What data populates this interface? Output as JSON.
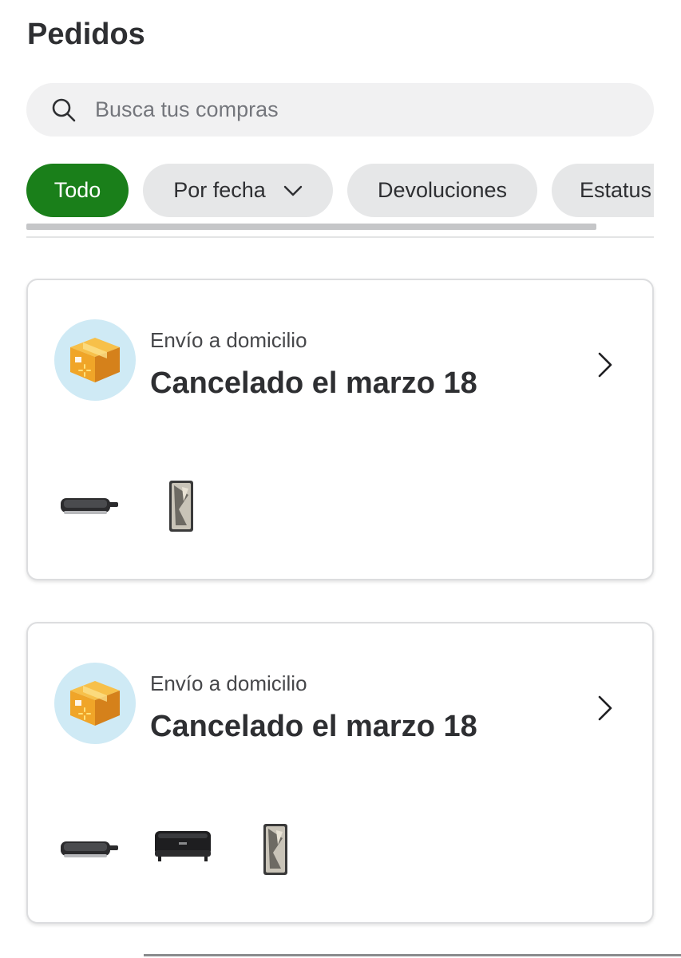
{
  "header": {
    "title": "Pedidos"
  },
  "search": {
    "placeholder": "Busca tus compras",
    "icon": "search-icon"
  },
  "filters": [
    {
      "label": "Todo",
      "active": true
    },
    {
      "label": "Por fecha",
      "active": false,
      "icon": "chevron-down-icon"
    },
    {
      "label": "Devoluciones",
      "active": false
    },
    {
      "label": "Estatus",
      "active": false
    }
  ],
  "orders": [
    {
      "type": "Envío a domicilio",
      "status": "Cancelado el marzo 18",
      "products": [
        "griddle-product-image",
        "phone-product-image"
      ]
    },
    {
      "type": "Envío a domicilio",
      "status": "Cancelado el marzo 18",
      "products": [
        "griddle-product-image",
        "sandwich-maker-product-image",
        "phone-product-image"
      ]
    }
  ],
  "colors": {
    "accent": "#1a7f1a",
    "chip": "#e6e7e8",
    "search_bg": "#f1f1f2",
    "avatar_bg": "#cfeaf5",
    "box": "#f0a528"
  }
}
